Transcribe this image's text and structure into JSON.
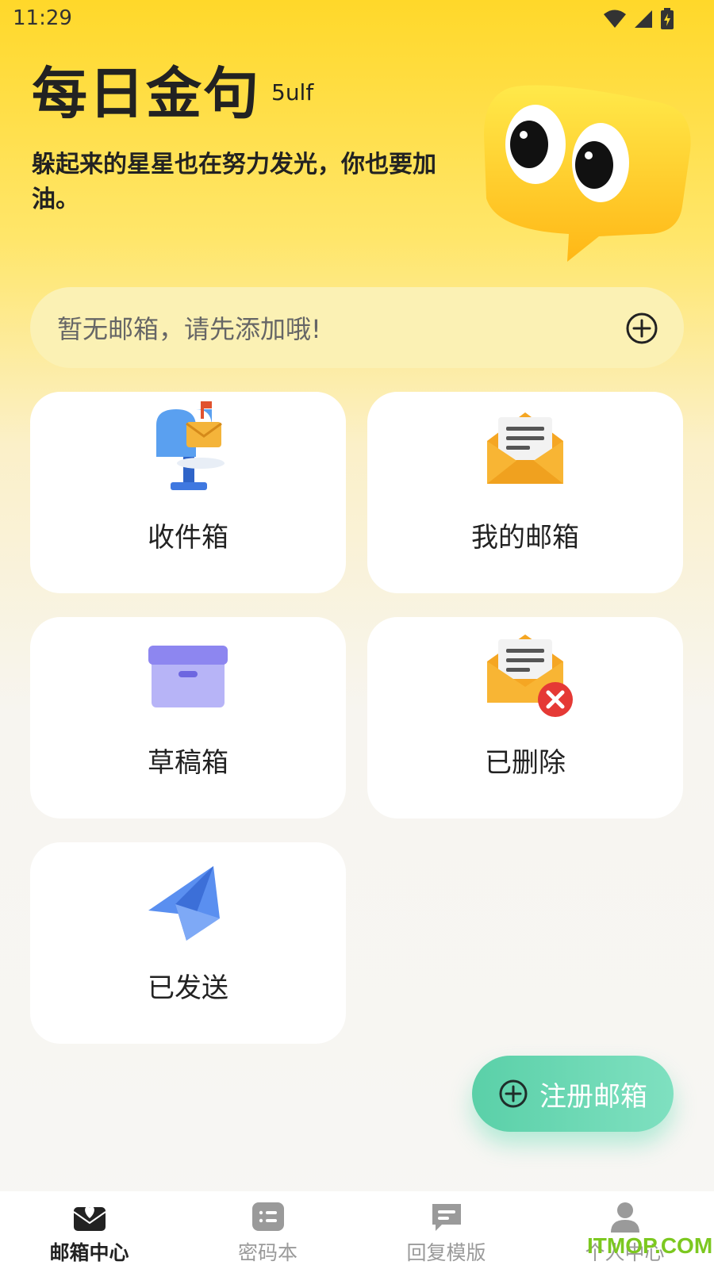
{
  "status_bar": {
    "time": "11:29"
  },
  "header": {
    "title": "每日金句",
    "tag": "5ulf",
    "quote": "躲起来的星星也在努力发光，你也要加油。"
  },
  "mailbox_bar": {
    "placeholder": "暂无邮箱，请先添加哦!",
    "add_icon": "plus-circle-icon"
  },
  "folders": [
    {
      "label": "收件箱",
      "icon": "mailbox-icon"
    },
    {
      "label": "我的邮箱",
      "icon": "envelope-open-icon"
    },
    {
      "label": "草稿箱",
      "icon": "archive-box-icon"
    },
    {
      "label": "已删除",
      "icon": "envelope-delete-icon"
    },
    {
      "label": "已发送",
      "icon": "paper-plane-icon"
    }
  ],
  "fab": {
    "label": "注册邮箱",
    "icon": "plus-circle-icon"
  },
  "bottom_nav": {
    "items": [
      {
        "label": "邮箱中心",
        "icon": "mail-heart-icon",
        "active": true
      },
      {
        "label": "密码本",
        "icon": "keyboard-icon",
        "active": false
      },
      {
        "label": "回复模版",
        "icon": "message-icon",
        "active": false
      },
      {
        "label": "个人中心",
        "icon": "user-icon",
        "active": false
      }
    ]
  },
  "watermark": "ITMOP.COM",
  "colors": {
    "accent": "#ffd82a",
    "fab": "#5ad0a8",
    "delete": "#e53935"
  }
}
